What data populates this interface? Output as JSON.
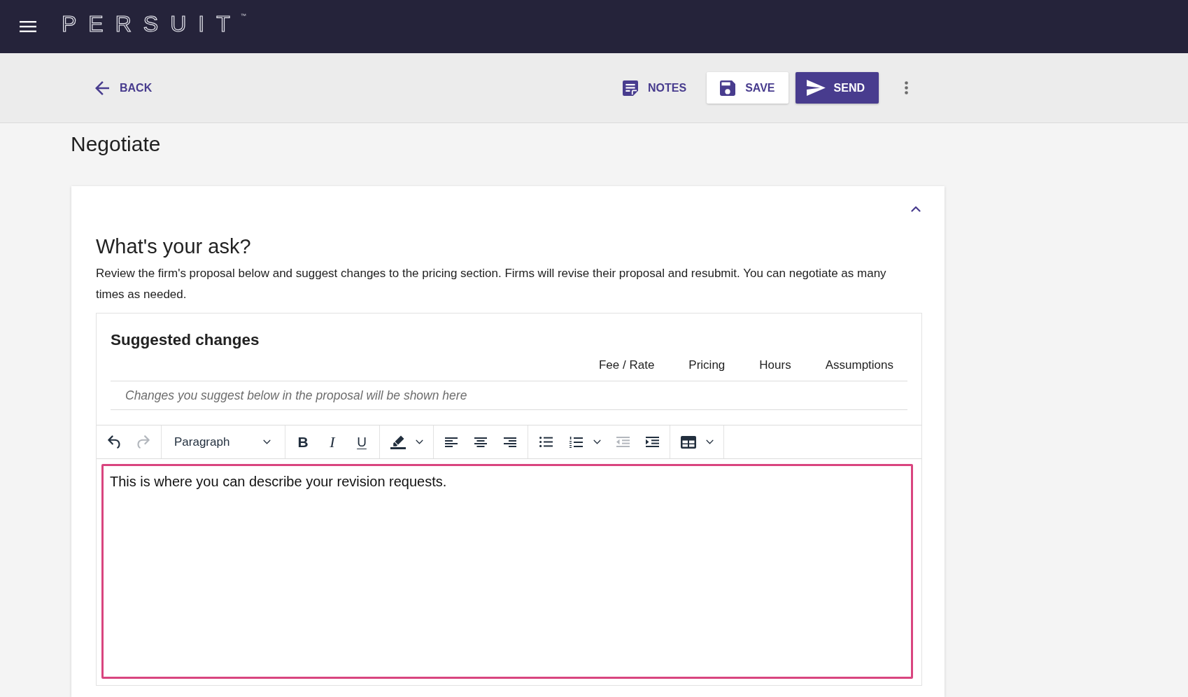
{
  "top_bar": {
    "logo": "PERSUIT",
    "trademark": "™"
  },
  "action_bar": {
    "back": "BACK",
    "actions": [
      {
        "kind": "notes",
        "label": "NOTES"
      },
      {
        "kind": "save",
        "label": "SAVE"
      },
      {
        "kind": "send",
        "label": "SEND"
      }
    ]
  },
  "page": {
    "title": "Negotiate"
  },
  "card": {
    "expanded": true,
    "heading": "What's your ask?",
    "description": "Review the firm's proposal below and suggest changes to the pricing section. Firms will revise their proposal and resubmit. You can negotiate as many times as needed.",
    "suggested_changes": {
      "title": "Suggested changes",
      "columns": [
        "Fee / Rate",
        "Pricing",
        "Hours",
        "Assumptions"
      ],
      "empty_message": "Changes you suggest below in the proposal will be shown here"
    },
    "editor": {
      "toolbar": [
        {
          "items": [
            {
              "kind": "undo",
              "disabled": false,
              "has_menu": false
            },
            {
              "kind": "redo",
              "disabled": true,
              "has_menu": false
            }
          ]
        },
        {
          "items": [
            {
              "kind": "select",
              "value": "Paragraph",
              "disabled": false
            }
          ]
        },
        {
          "items": [
            {
              "kind": "bold",
              "label": "B",
              "disabled": false,
              "has_menu": false
            },
            {
              "kind": "italic",
              "label": "I",
              "disabled": false,
              "has_menu": false
            },
            {
              "kind": "underline",
              "label": "U",
              "disabled": false,
              "has_menu": false
            }
          ]
        },
        {
          "items": [
            {
              "kind": "highlight",
              "disabled": false,
              "has_menu": true
            }
          ]
        },
        {
          "items": [
            {
              "kind": "align_left",
              "disabled": false,
              "has_menu": false
            },
            {
              "kind": "align_center",
              "disabled": false,
              "has_menu": false
            },
            {
              "kind": "align_right",
              "disabled": false,
              "has_menu": false
            }
          ]
        },
        {
          "items": [
            {
              "kind": "bullet_list",
              "disabled": false,
              "has_menu": false
            },
            {
              "kind": "numbered_list",
              "disabled": false,
              "has_menu": true
            },
            {
              "kind": "outdent",
              "disabled": true,
              "has_menu": false
            },
            {
              "kind": "indent",
              "disabled": false,
              "has_menu": false
            }
          ]
        },
        {
          "items": [
            {
              "kind": "table",
              "disabled": false,
              "has_menu": true
            }
          ]
        }
      ],
      "focused": true,
      "value": "This is where you can describe your revision requests."
    }
  }
}
